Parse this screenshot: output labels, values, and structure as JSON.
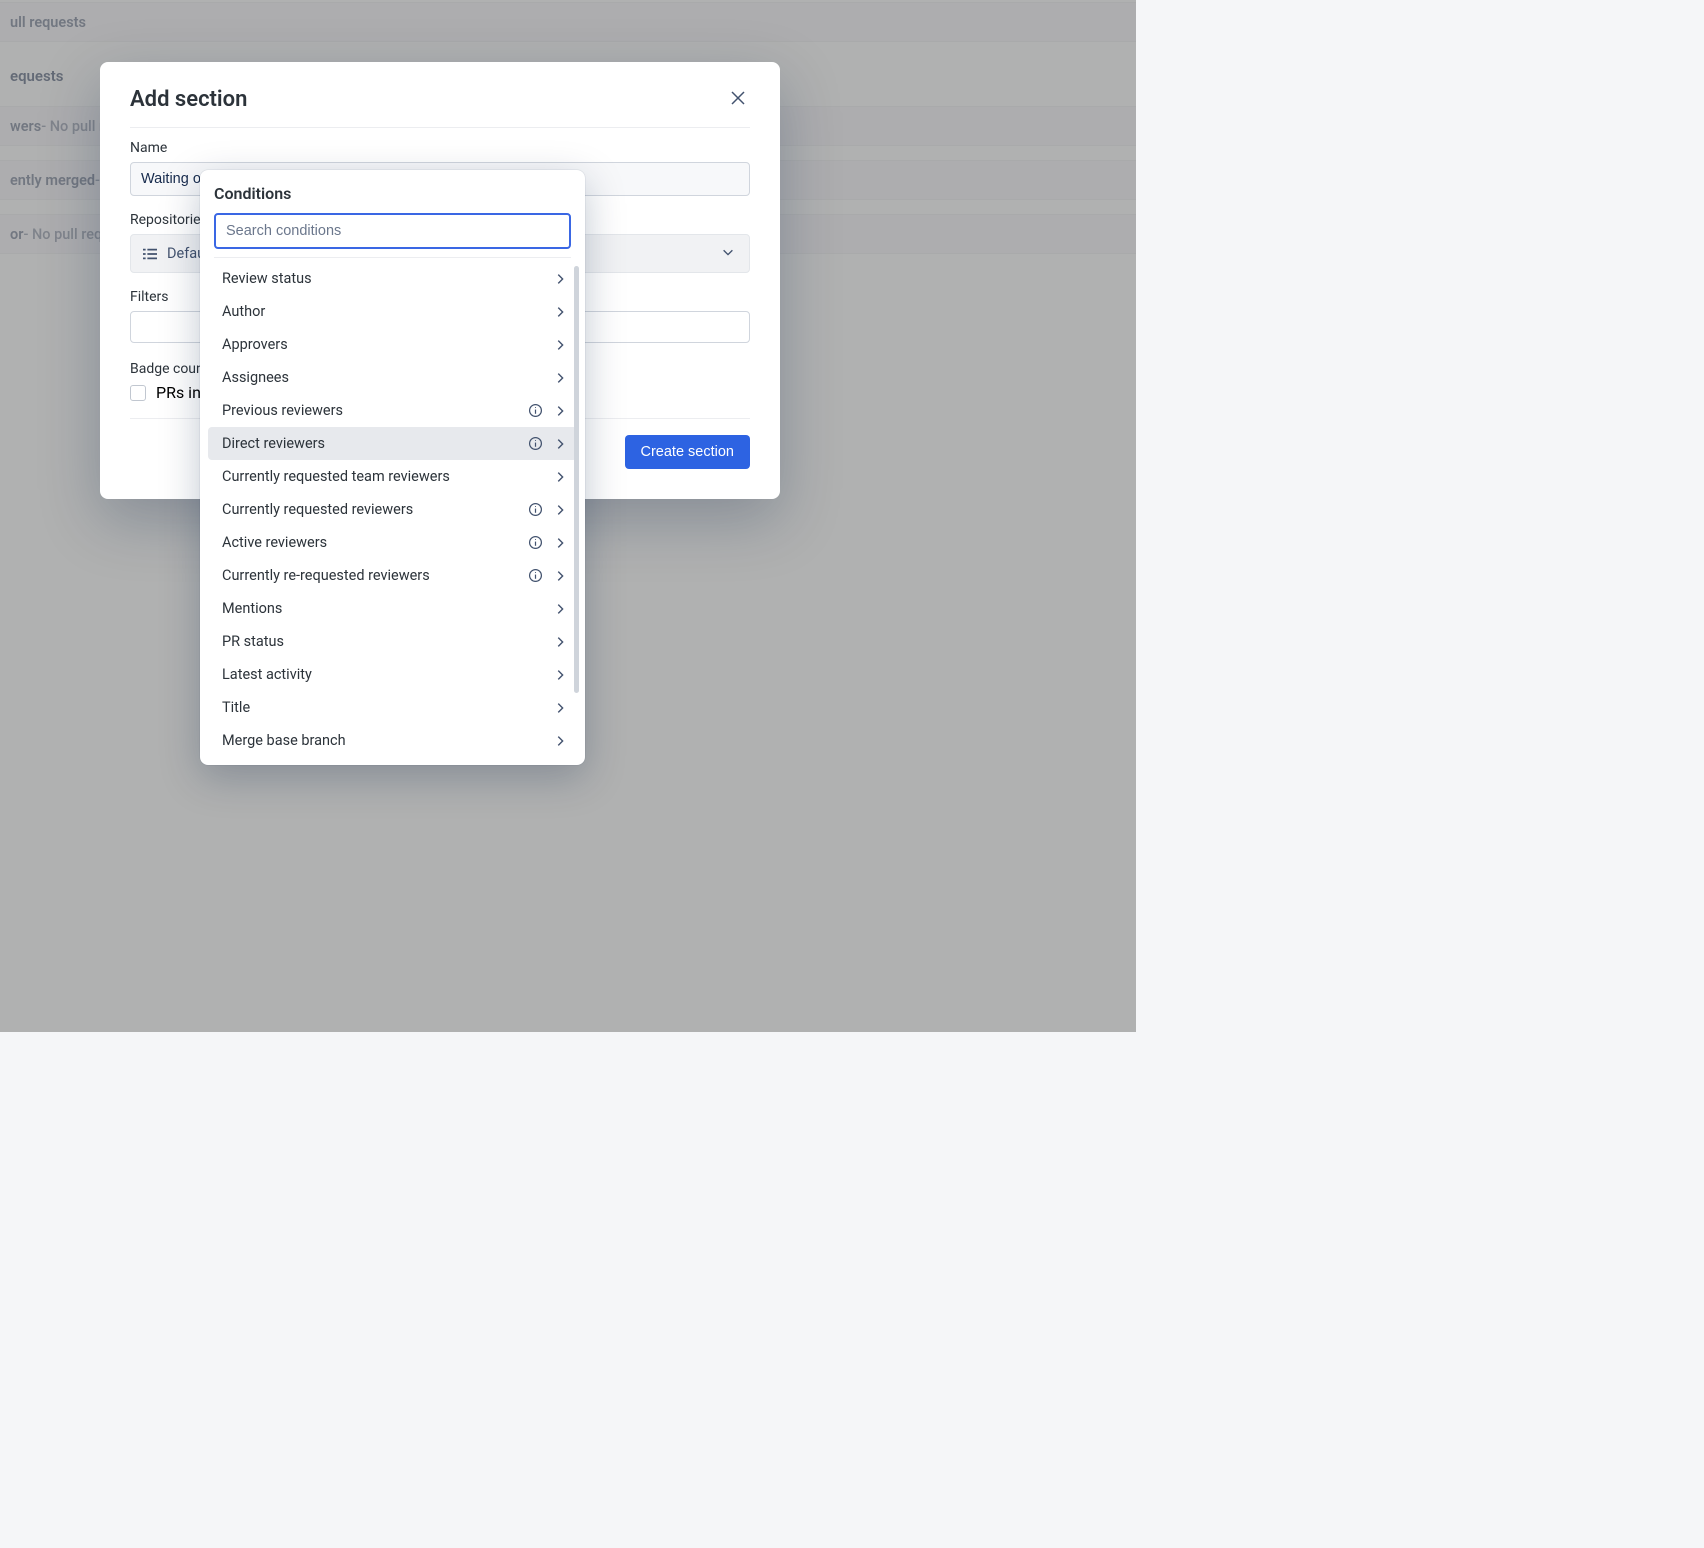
{
  "background": {
    "header1": "ull requests",
    "header2": "equests",
    "rows": [
      {
        "label": "wers",
        "suffix": " - No pull re"
      },
      {
        "label": "ently merged",
        "suffix": " - N"
      },
      {
        "label": "or",
        "suffix": " - No pull reque"
      }
    ]
  },
  "modal": {
    "title": "Add section",
    "name_label": "Name",
    "name_value": "Waiting on me for a merge",
    "repos_label": "Repositories",
    "repos_value": "Default",
    "filters_label": "Filters",
    "badge_label": "Badge count",
    "badge_checkbox_label": "PRs in thi",
    "create_button": "Create section"
  },
  "conditions": {
    "title": "Conditions",
    "search_placeholder": "Search conditions",
    "items": [
      {
        "label": "Review status",
        "info": false,
        "selected": false
      },
      {
        "label": "Author",
        "info": false,
        "selected": false
      },
      {
        "label": "Approvers",
        "info": false,
        "selected": false
      },
      {
        "label": "Assignees",
        "info": false,
        "selected": false
      },
      {
        "label": "Previous reviewers",
        "info": true,
        "selected": false
      },
      {
        "label": "Direct reviewers",
        "info": true,
        "selected": true
      },
      {
        "label": "Currently requested team reviewers",
        "info": false,
        "selected": false
      },
      {
        "label": "Currently requested reviewers",
        "info": true,
        "selected": false
      },
      {
        "label": "Active reviewers",
        "info": true,
        "selected": false
      },
      {
        "label": "Currently re-requested reviewers",
        "info": true,
        "selected": false
      },
      {
        "label": "Mentions",
        "info": false,
        "selected": false
      },
      {
        "label": "PR status",
        "info": false,
        "selected": false
      },
      {
        "label": "Latest activity",
        "info": false,
        "selected": false
      },
      {
        "label": "Title",
        "info": false,
        "selected": false
      },
      {
        "label": "Merge base branch",
        "info": false,
        "selected": false
      }
    ]
  }
}
